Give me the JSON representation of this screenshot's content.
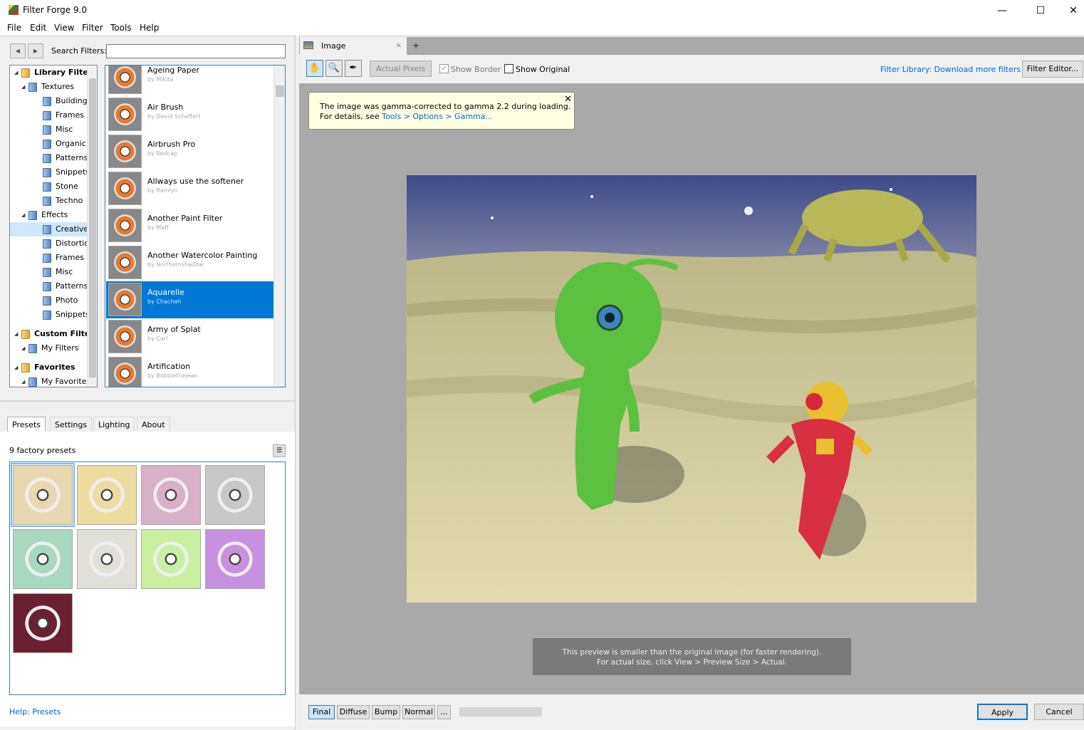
{
  "window": {
    "title": "Filter Forge 9.0"
  },
  "menu": [
    "File",
    "Edit",
    "View",
    "Filter",
    "Tools",
    "Help"
  ],
  "search": {
    "label": "Search Filters:",
    "value": ""
  },
  "tree": [
    {
      "label": "Library Filters",
      "level": 0,
      "bold": true
    },
    {
      "label": "Textures",
      "level": 1
    },
    {
      "label": "Building",
      "level": 2
    },
    {
      "label": "Frames",
      "level": 2
    },
    {
      "label": "Misc",
      "level": 2
    },
    {
      "label": "Organic",
      "level": 2
    },
    {
      "label": "Patterns",
      "level": 2
    },
    {
      "label": "Snippets",
      "level": 2
    },
    {
      "label": "Stone",
      "level": 2
    },
    {
      "label": "Techno",
      "level": 2
    },
    {
      "label": "Effects",
      "level": 1
    },
    {
      "label": "Creative",
      "level": 2,
      "selected": true
    },
    {
      "label": "Distortion",
      "level": 2
    },
    {
      "label": "Frames",
      "level": 2
    },
    {
      "label": "Misc",
      "level": 2
    },
    {
      "label": "Patterns",
      "level": 2
    },
    {
      "label": "Photo",
      "level": 2
    },
    {
      "label": "Snippets",
      "level": 2
    },
    {
      "label": "Custom Filters",
      "level": 0,
      "bold": true
    },
    {
      "label": "My Filters",
      "level": 1
    },
    {
      "label": "Favorites",
      "level": 0,
      "bold": true
    },
    {
      "label": "My Favorites",
      "level": 1
    }
  ],
  "filters": [
    {
      "name": "Ageing Paper",
      "author": "by Mikita"
    },
    {
      "name": "Air Brush",
      "author": "by David Scheffert"
    },
    {
      "name": "Airbrush Pro",
      "author": "by Redcap"
    },
    {
      "name": "Allways use the softener",
      "author": "by Ramlyn"
    },
    {
      "name": "Another Paint Filter",
      "author": "by Maff"
    },
    {
      "name": "Another Watercolor Painting",
      "author": "by Northernshadow"
    },
    {
      "name": "Aquarelle",
      "author": "by Chachah",
      "selected": true
    },
    {
      "name": "Army of Splat",
      "author": "by Carl"
    },
    {
      "name": "Artification",
      "author": "by Bobbiethejean"
    }
  ],
  "bottom_tabs": [
    "Presets",
    "Settings",
    "Lighting",
    "About"
  ],
  "presets": {
    "count_label": "9 factory presets",
    "colors": [
      "#e8d8b0",
      "#ecdca0",
      "#d8b0c8",
      "#c8c8c8",
      "#a8d8c0",
      "#e0e0d8",
      "#c8f0a0",
      "#c890e0",
      "#6a2030"
    ]
  },
  "help_link": "Help: Presets",
  "doc_tab": {
    "label": "Image",
    "close": "×",
    "add": "+"
  },
  "toolbar": {
    "actual_pixels": "Actual Pixels",
    "show_border": "Show Border",
    "show_original": "Show Original",
    "library_link": "Filter Library: Download more filters",
    "filter_editor": "Filter Editor..."
  },
  "notice": {
    "line1": "The image was gamma-corrected to gamma 2.2 during loading.",
    "line2_prefix": "For details, see ",
    "line2_link": "Tools > Options > Gamma..."
  },
  "info": {
    "line1": "This preview is smaller than the original image (for faster rendering).",
    "line2": "For actual size, click View > Preview Size > Actual."
  },
  "maps": [
    "Final",
    "Diffuse",
    "Bump",
    "Normal",
    "..."
  ],
  "buttons": {
    "apply": "Apply",
    "cancel": "Cancel"
  }
}
